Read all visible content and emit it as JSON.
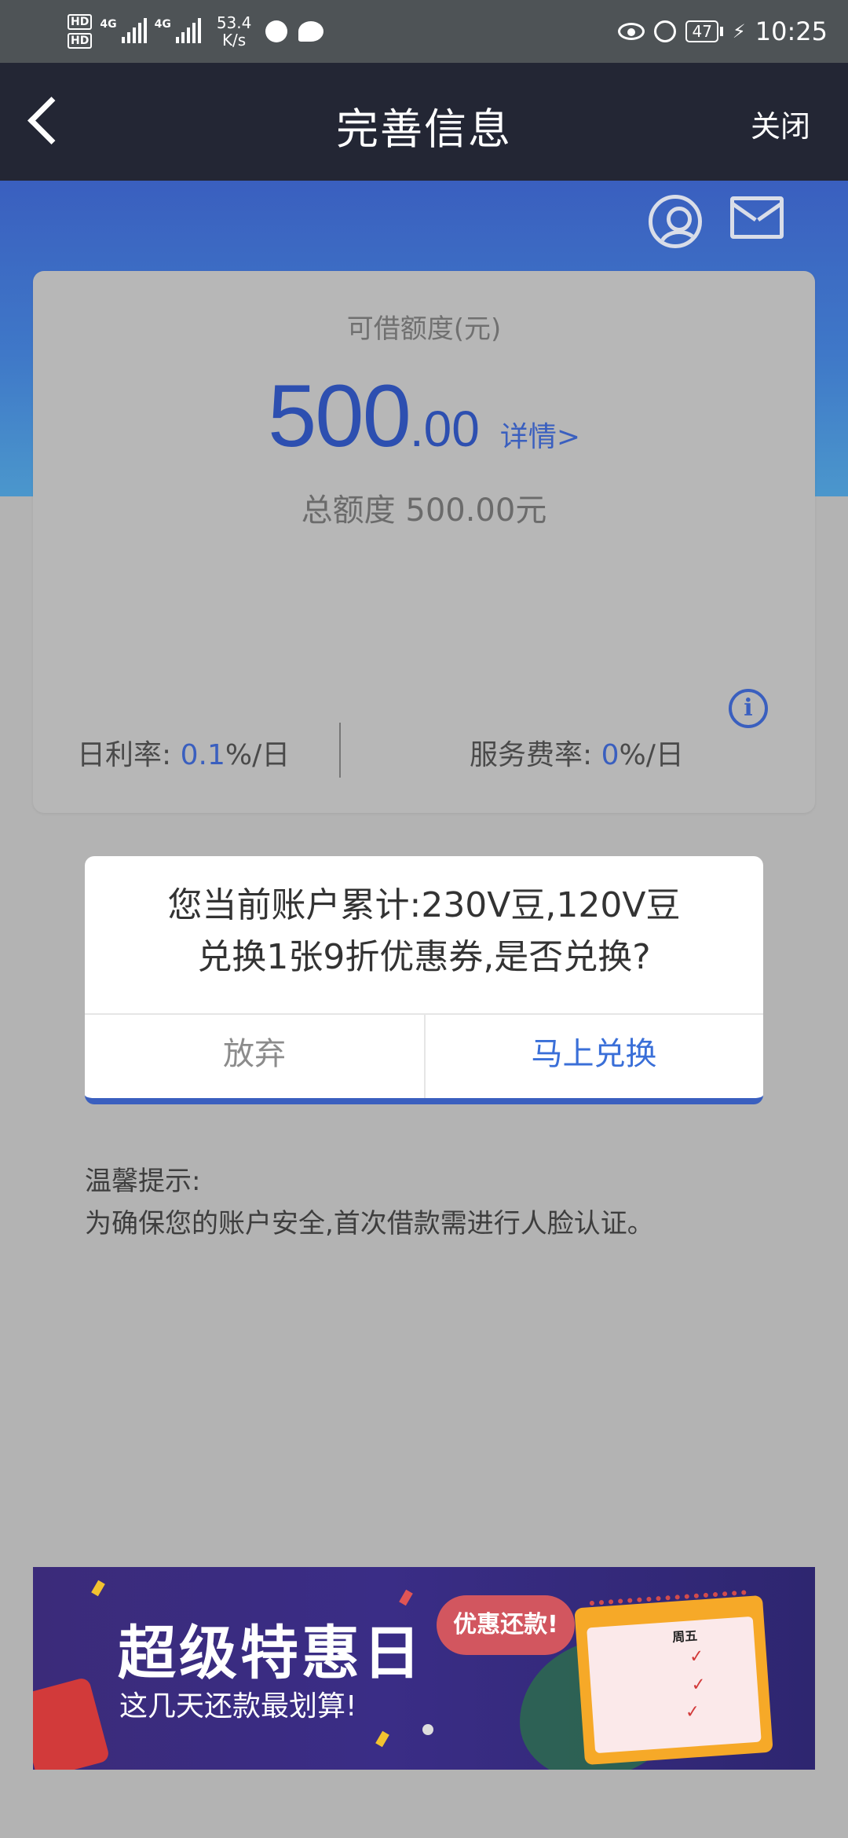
{
  "status_bar": {
    "hd1": "HD",
    "hd2": "HD",
    "net1": "4G",
    "net2": "4G",
    "speed_value": "53.4",
    "speed_unit": "K/s",
    "battery": "47",
    "time": "10:25"
  },
  "header": {
    "title": "完善信息",
    "close": "关闭"
  },
  "card": {
    "credit_label": "可借额度(元)",
    "amount_int": "500",
    "amount_dec": ".00",
    "detail": "详情>",
    "total_quota": "总额度 500.00元",
    "daily_rate_label": "日利率:",
    "daily_rate_value": "0.1",
    "daily_rate_unit": "%/日",
    "service_rate_label": "服务费率:",
    "service_rate_value": "0",
    "service_rate_unit": "%/日",
    "info_glyph": "i"
  },
  "modal": {
    "line1": "您当前账户累计:230V豆,120V豆",
    "line2": "兑换1张9折优惠券,是否兑换?",
    "give_up": "放弃",
    "exchange": "马上兑换"
  },
  "tips": {
    "title": "温馨提示:",
    "text": "为确保您的账户安全,首次借款需进行人脸认证。"
  },
  "banner": {
    "title": "超级特惠日",
    "subtitle": "这几天还款最划算!",
    "bubble": "优惠还款!",
    "weekday": "周五"
  }
}
